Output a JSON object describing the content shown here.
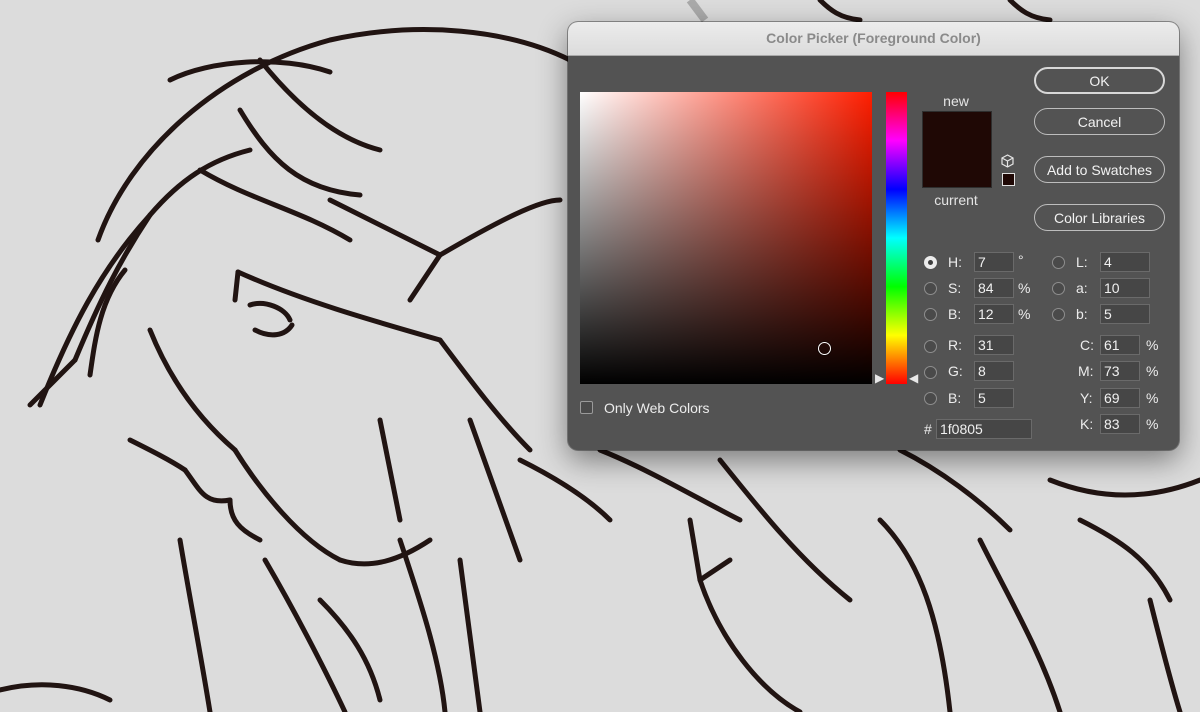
{
  "dialog": {
    "title": "Color Picker (Foreground Color)",
    "selected_hue_deg": 7,
    "selected_saturation": 0.84,
    "selected_brightness": 0.12
  },
  "swatch": {
    "new_label": "new",
    "current_label": "current",
    "new_color": "#1f0805",
    "current_color": "#1f0805"
  },
  "buttons": {
    "ok": "OK",
    "cancel": "Cancel",
    "add_to_swatches": "Add to Swatches",
    "color_libraries": "Color Libraries"
  },
  "hsb": {
    "h_label": "H:",
    "h": "7",
    "h_unit": "°",
    "s_label": "S:",
    "s": "84",
    "s_unit": "%",
    "b_label": "B:",
    "b": "12",
    "b_unit": "%"
  },
  "rgb": {
    "r_label": "R:",
    "r": "31",
    "g_label": "G:",
    "g": "8",
    "b_label": "B:",
    "b": "5"
  },
  "lab": {
    "l_label": "L:",
    "l": "4",
    "a_label": "a:",
    "a": "10",
    "b_label": "b:",
    "b": "5"
  },
  "cmyk": {
    "c_label": "C:",
    "c": "61",
    "c_unit": "%",
    "m_label": "M:",
    "m": "73",
    "m_unit": "%",
    "y_label": "Y:",
    "y": "69",
    "y_unit": "%",
    "k_label": "K:",
    "k": "83",
    "k_unit": "%"
  },
  "hex": {
    "label": "#",
    "value": "1f0805"
  },
  "web_colors": {
    "label": "Only Web Colors",
    "checked": false
  },
  "colors": {
    "line_art": "#211412",
    "canvas_bg": "#dcdcdc",
    "dialog_bg": "#535353"
  }
}
